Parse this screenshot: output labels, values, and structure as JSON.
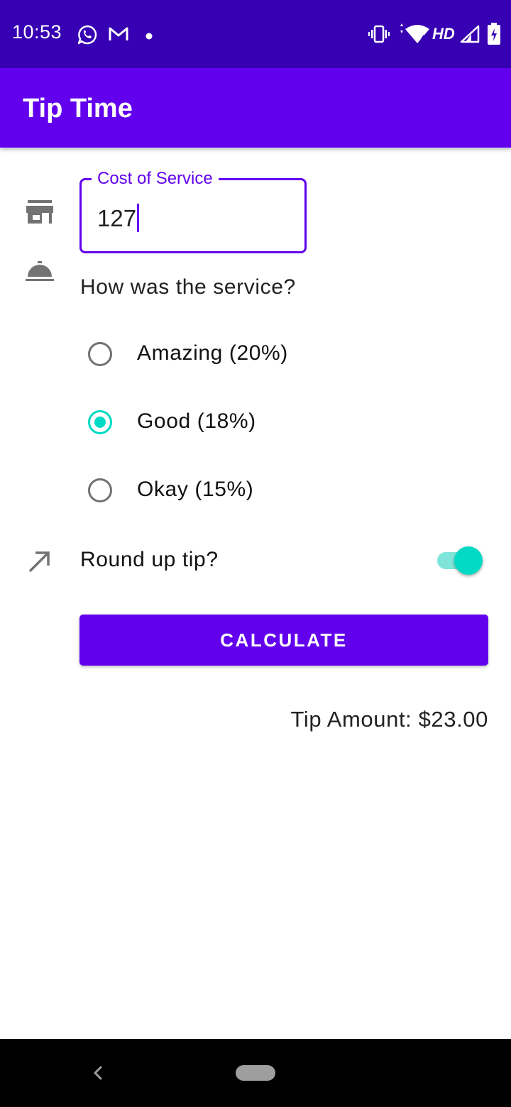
{
  "status_bar": {
    "time": "10:53",
    "network": "HD",
    "icons": [
      "whatsapp-icon",
      "gmail-icon",
      "notification-dot-icon",
      "vibrate-icon",
      "wifi-icon",
      "signal-icon",
      "battery-charging-icon"
    ]
  },
  "app_bar": {
    "title": "Tip Time"
  },
  "cost_field": {
    "label": "Cost of Service",
    "value": "127",
    "icon": "storefront-icon"
  },
  "service": {
    "question": "How was the service?",
    "icon": "room-service-icon",
    "options": [
      {
        "label": "Amazing (20%)",
        "checked": false
      },
      {
        "label": "Good (18%)",
        "checked": true
      },
      {
        "label": "Okay (15%)",
        "checked": false
      }
    ]
  },
  "round_up": {
    "label": "Round up tip?",
    "icon": "round-up-arrow-icon",
    "enabled": true
  },
  "calculate_button": {
    "label": "CALCULATE"
  },
  "result": {
    "text": "Tip Amount: $23.00"
  },
  "colors": {
    "primary": "#6200ee",
    "primary_dark": "#3700b3",
    "accent": "#03dac5",
    "icon_gray": "#737373"
  },
  "nav_bar": {
    "icons": [
      "back-icon",
      "home-pill-icon"
    ]
  }
}
